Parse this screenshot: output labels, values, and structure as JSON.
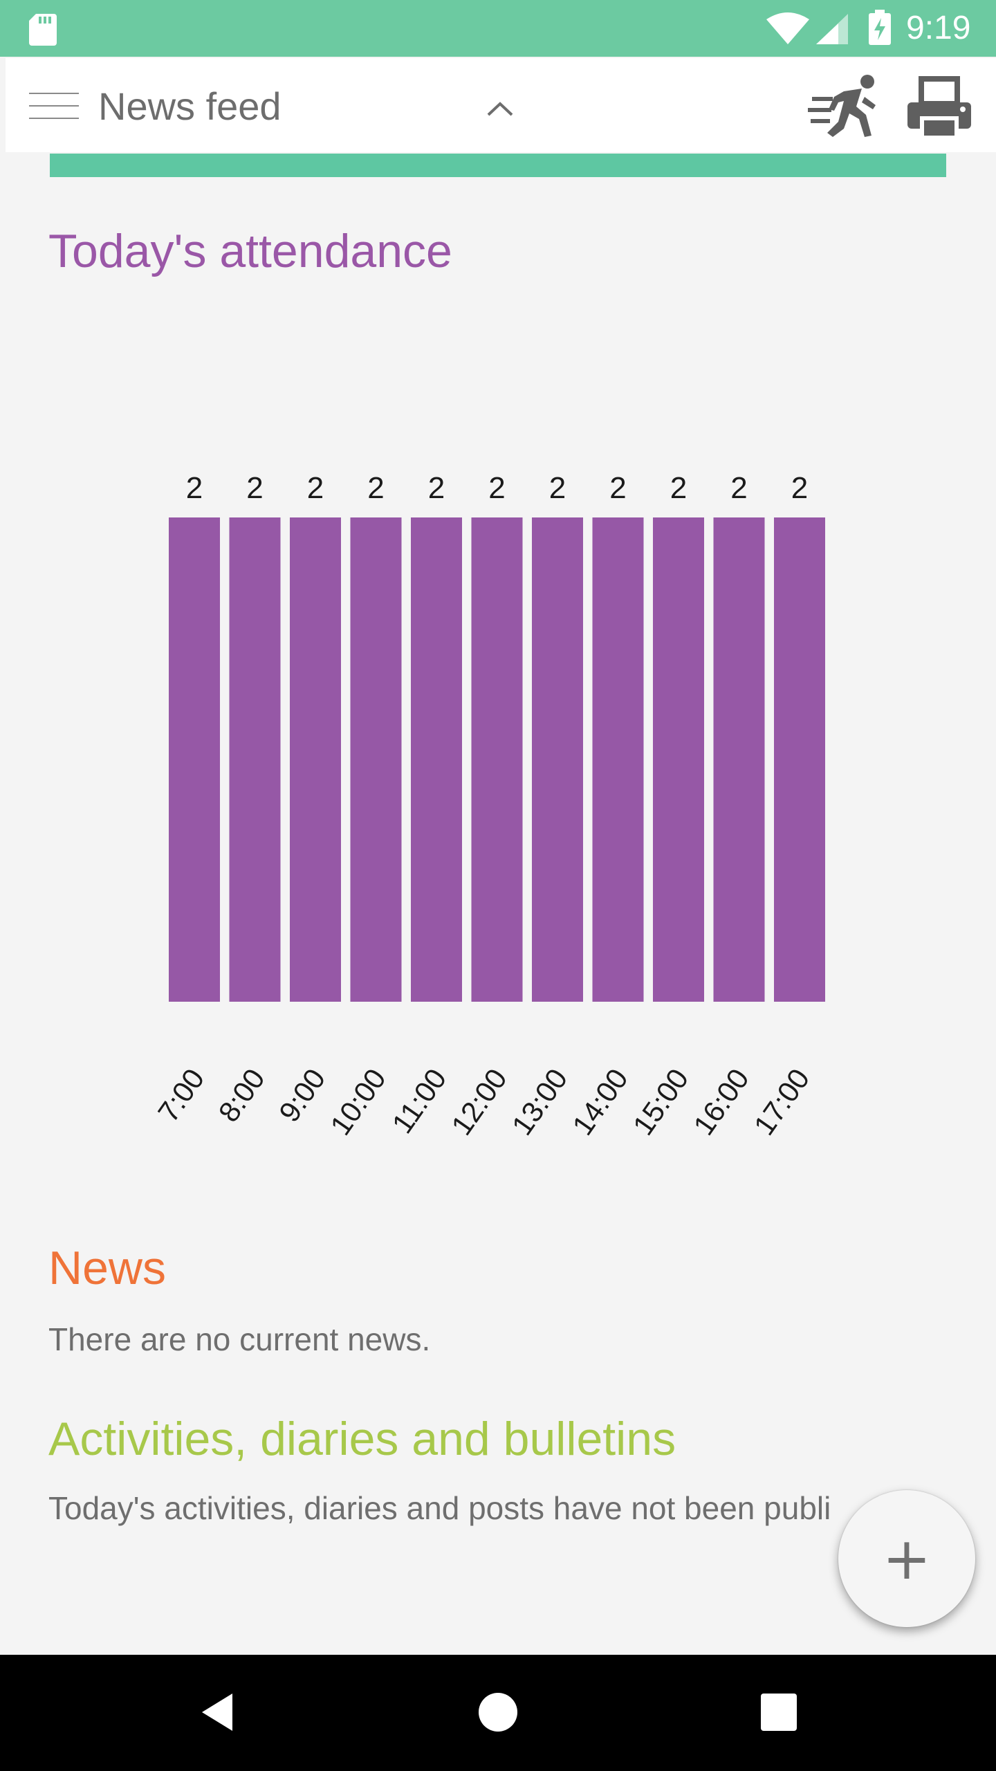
{
  "status_bar": {
    "time": "9:19",
    "icons": [
      "sd-card-icon",
      "wifi-icon",
      "cell-signal-icon",
      "battery-charging-icon"
    ]
  },
  "toolbar": {
    "menu_icon": "hamburger-menu-icon",
    "title": "News feed",
    "chevron_icon": "chevron-up-icon",
    "actions": [
      "running-person-icon",
      "printer-icon"
    ]
  },
  "attendance": {
    "title": "Today's attendance"
  },
  "chart_data": {
    "type": "bar",
    "title": "",
    "xlabel": "",
    "ylabel": "",
    "categories": [
      "7:00",
      "8:00",
      "9:00",
      "10:00",
      "11:00",
      "12:00",
      "13:00",
      "14:00",
      "15:00",
      "16:00",
      "17:00"
    ],
    "values": [
      2,
      2,
      2,
      2,
      2,
      2,
      2,
      2,
      2,
      2,
      2
    ],
    "ylim": [
      0,
      2
    ],
    "grid": false,
    "legend": "none",
    "bar_color": "#9658a6",
    "data_labels": true
  },
  "news": {
    "title": "News",
    "empty_text": "There are no current news."
  },
  "activities": {
    "title": "Activities, diaries and bulletins",
    "empty_text": "Today's activities, diaries and posts have not been publi"
  },
  "fab": {
    "label": "+",
    "icon": "plus-icon"
  },
  "nav_bar": {
    "icons": [
      "back-triangle-icon",
      "home-circle-icon",
      "recents-square-icon"
    ]
  },
  "colors": {
    "status_bar": "#6ccaa1",
    "accent_bar": "#5ec7a2",
    "attendance_title": "#9a57a7",
    "news_title": "#ef7338",
    "activities_title": "#a7c84a",
    "body_text": "#6e6e6e"
  }
}
